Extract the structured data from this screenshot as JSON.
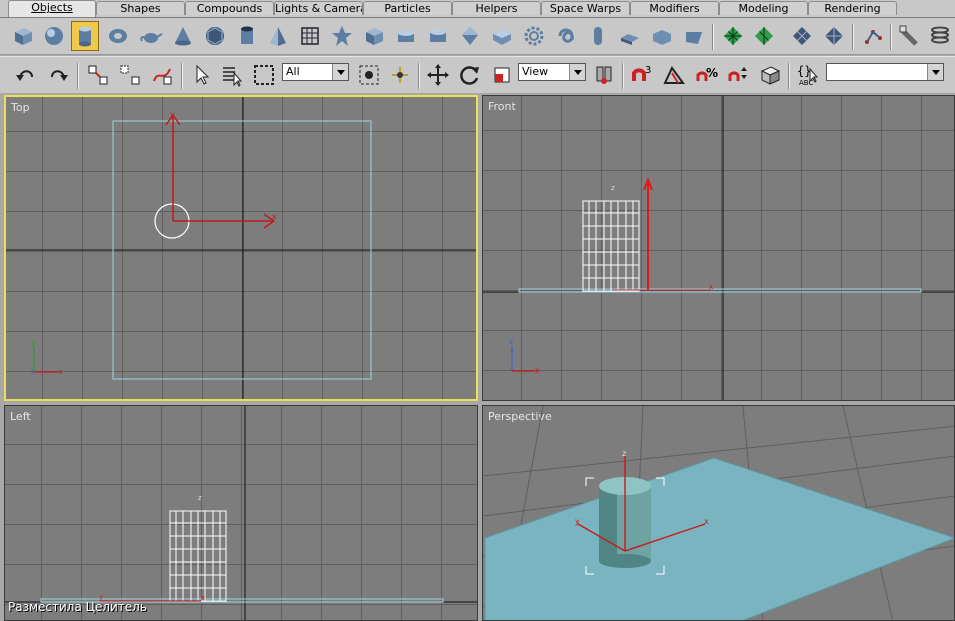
{
  "tabs": [
    "Objects",
    "Shapes",
    "Compounds",
    "Lights & Cameras",
    "Particles",
    "Helpers",
    "Space Warps",
    "Modifiers",
    "Modeling",
    "Rendering"
  ],
  "active_tab": "Objects",
  "toolbar2": {
    "selection_filter": "All",
    "reference_coord": "View",
    "named_selection": ""
  },
  "viewports": {
    "top": "Top",
    "front": "Front",
    "left": "Left",
    "perspective": "Perspective"
  },
  "axis_labels": {
    "x": "x",
    "y": "y",
    "z": "z"
  },
  "caption": "Разместила Целитель",
  "colors": {
    "active_viewport_border": "#e8e05a",
    "grid_bg": "#7d7d7d",
    "plane": "#7ab4c0",
    "cylinder": "#6fa3a3",
    "gizmo": "#c21b1b"
  }
}
